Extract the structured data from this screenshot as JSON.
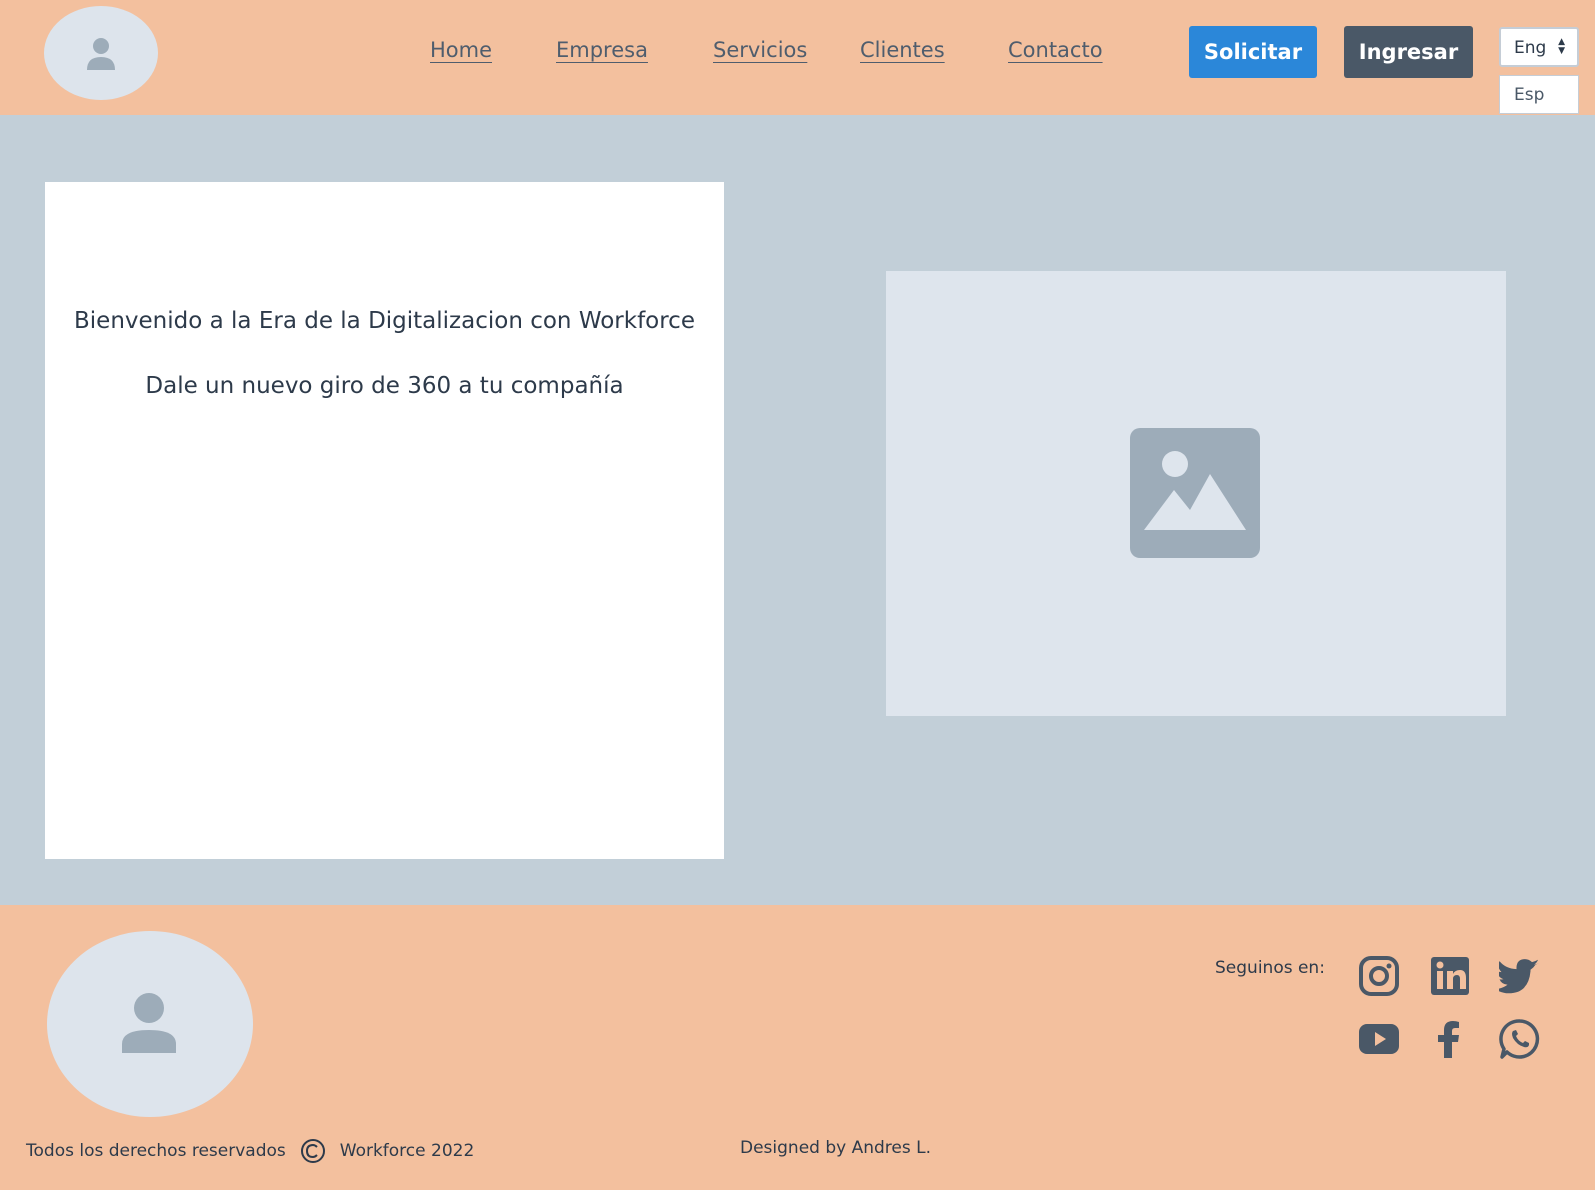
{
  "header": {
    "logo_icon": "user-icon",
    "nav": [
      {
        "label": "Home"
      },
      {
        "label": "Empresa"
      },
      {
        "label": "Servicios"
      },
      {
        "label": "Clientes"
      },
      {
        "label": "Contacto"
      }
    ],
    "solicitar_label": "Solicitar",
    "ingresar_label": "Ingresar",
    "language": {
      "selected": "Eng",
      "options": [
        "Esp"
      ]
    }
  },
  "hero": {
    "title": "Bienvenido a la Era de la Digitalizacion con Workforce",
    "subtitle": "Dale un nuevo giro de 360 a tu compañía",
    "image_icon": "image-icon"
  },
  "footer": {
    "logo_icon": "user-icon",
    "follow_label": "Seguinos en:",
    "social": [
      "instagram-icon",
      "linkedin-icon",
      "twitter-icon",
      "youtube-icon",
      "facebook-icon",
      "whatsapp-icon"
    ],
    "rights": "Todos los derechos reservados",
    "company": "Workforce 2022",
    "designed_by": "Designed by Andres L."
  },
  "colors": {
    "header_bg": "#f3c09e",
    "main_bg": "#c2cfd8",
    "primary_button": "#2b87d9",
    "secondary_button": "#4a5867",
    "placeholder_bg": "#dee5ed",
    "icon_gray": "#9dacb9"
  }
}
